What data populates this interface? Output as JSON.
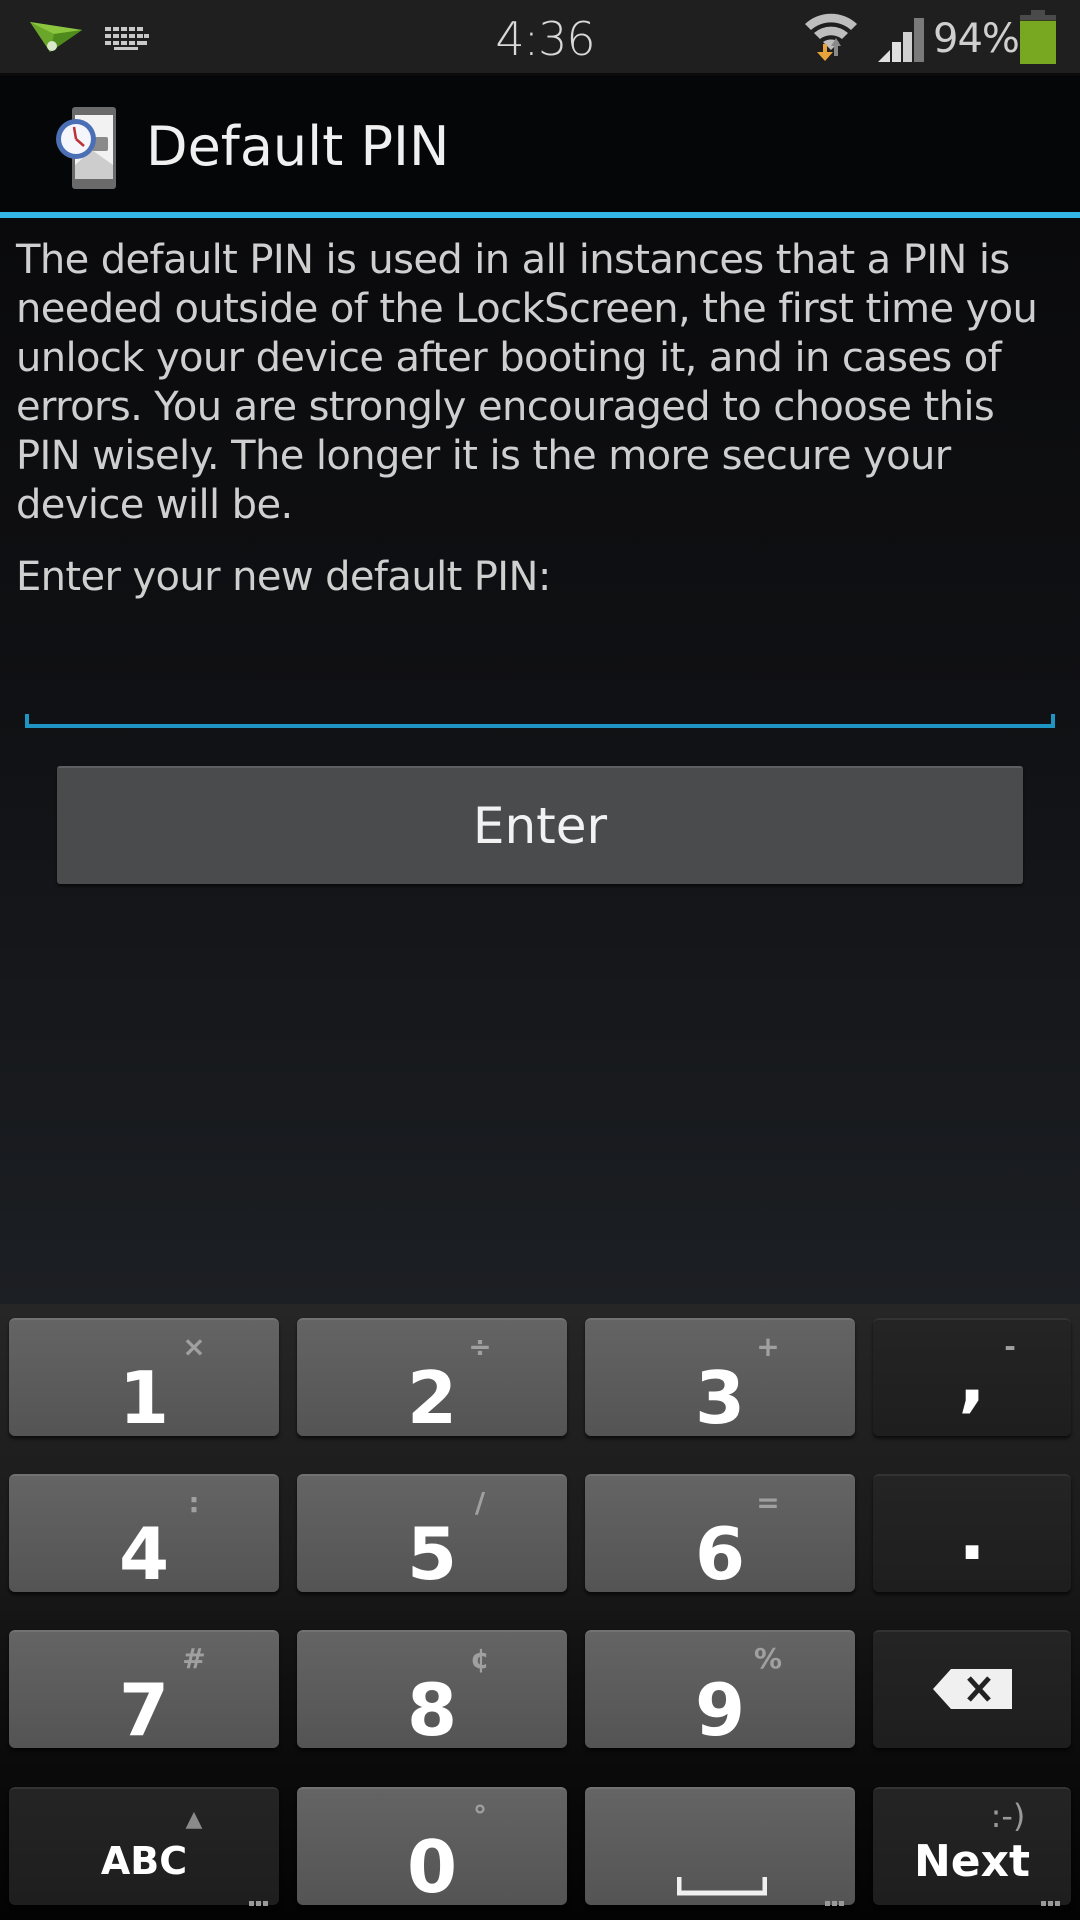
{
  "status_bar": {
    "time": "4:36",
    "battery_percent": "94%",
    "battery_level": 0.94,
    "battery_color": "#78a822",
    "left_icons": [
      "airdroid-icon",
      "keyboard-icon"
    ],
    "right_icons": [
      "wifi-icon",
      "signal-icon",
      "battery-icon"
    ]
  },
  "action_bar": {
    "title": "Default PIN",
    "app_icon": "phone-clock-lock-icon",
    "accent_color": "#33b5e5"
  },
  "content": {
    "description": "The default PIN is used in all instances that a PIN is needed outside of the LockScreen, the first time you unlock your device after booting it, and in cases of errors. You are strongly encouraged to choose this PIN wisely. The longer it is the more secure your device will be.",
    "prompt": "Enter your new default PIN:",
    "pin_input": {
      "value": "",
      "placeholder": ""
    },
    "enter_button": "Enter"
  },
  "keyboard": {
    "rows": [
      [
        {
          "main": "1",
          "sub": "×"
        },
        {
          "main": "2",
          "sub": "÷"
        },
        {
          "main": "3",
          "sub": "+"
        },
        {
          "main": ",",
          "sub": "-"
        }
      ],
      [
        {
          "main": "4",
          "sub": ":"
        },
        {
          "main": "5",
          "sub": "/"
        },
        {
          "main": "6",
          "sub": "="
        },
        {
          "main": ".",
          "sub": ""
        }
      ],
      [
        {
          "main": "7",
          "sub": "#"
        },
        {
          "main": "8",
          "sub": "¢"
        },
        {
          "main": "9",
          "sub": "%"
        },
        {
          "main": "",
          "sub": "",
          "icon": "backspace-icon"
        }
      ],
      [
        {
          "main": "ABC",
          "sub": "▲"
        },
        {
          "main": "0",
          "sub": "°"
        },
        {
          "main": "",
          "sub": "",
          "icon": "space-icon"
        },
        {
          "main": "Next",
          "sub": ":-)"
        }
      ]
    ]
  }
}
